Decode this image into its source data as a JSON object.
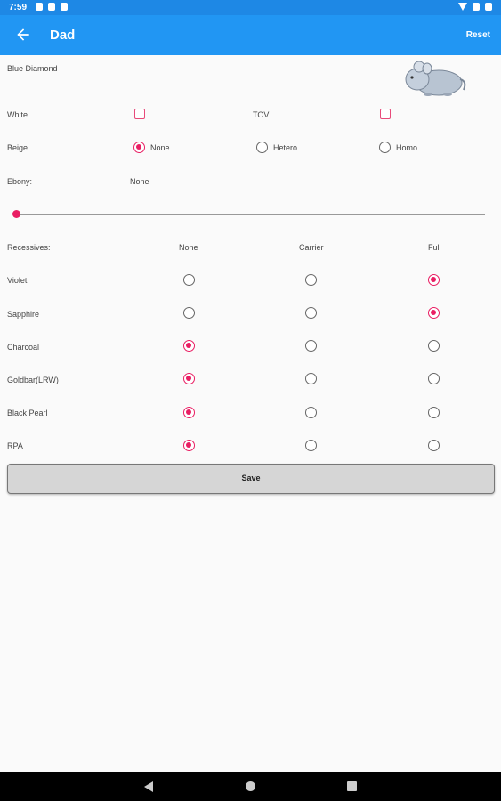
{
  "status_bar": {
    "time": "7:59"
  },
  "app_bar": {
    "title": "Dad",
    "reset_label": "Reset"
  },
  "header": {
    "color_label": "Blue Diamond",
    "image_name": "chinchilla-icon"
  },
  "white": {
    "label": "White",
    "checked": false
  },
  "tov": {
    "label": "TOV",
    "checked": false
  },
  "beige": {
    "label": "Beige",
    "options": [
      "None",
      "Hetero",
      "Homo"
    ],
    "selected": "None"
  },
  "ebony": {
    "label": "Ebony:",
    "value": "None",
    "slider_value": 0
  },
  "recessives": {
    "label": "Recessives:",
    "columns": [
      "None",
      "Carrier",
      "Full"
    ],
    "rows": [
      {
        "name": "Violet",
        "selected": "Full"
      },
      {
        "name": "Sapphire",
        "selected": "Full"
      },
      {
        "name": "Charcoal",
        "selected": "None"
      },
      {
        "name": "Goldbar(LRW)",
        "selected": "None"
      },
      {
        "name": "Black Pearl",
        "selected": "None"
      },
      {
        "name": "RPA",
        "selected": "None"
      }
    ]
  },
  "save_label": "Save",
  "accent_color": "#e91e63",
  "app_bar_color": "#2196f3"
}
